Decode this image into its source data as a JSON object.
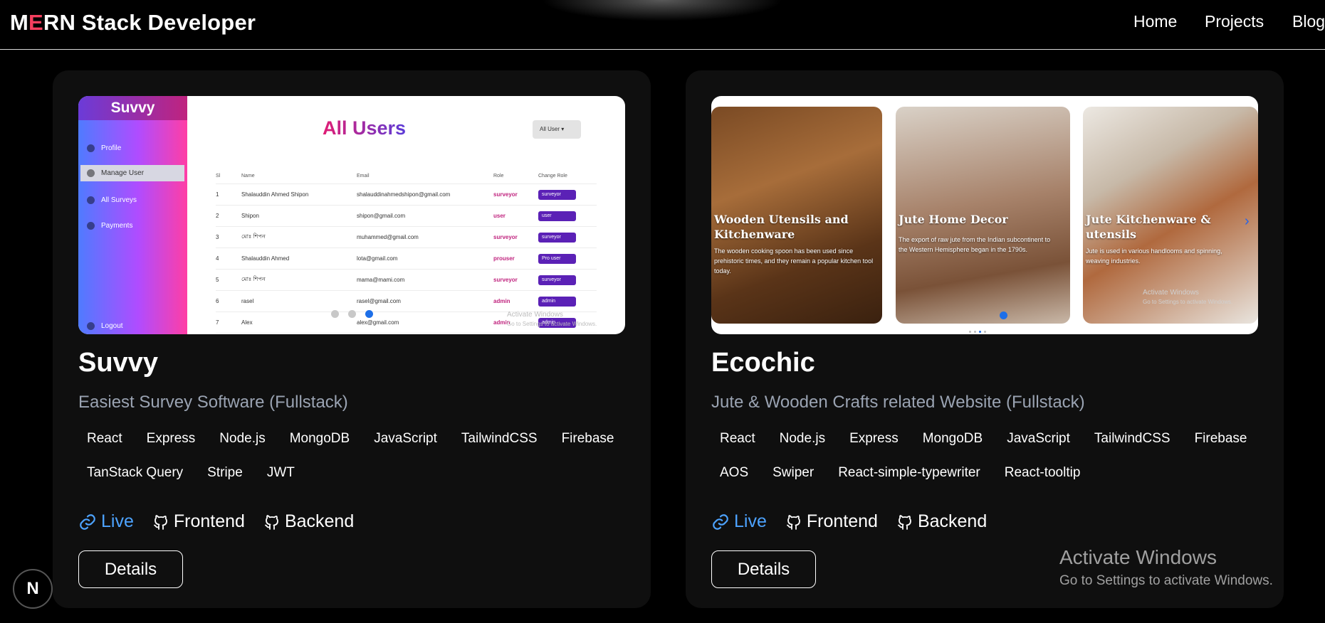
{
  "header": {
    "logo_first": "M",
    "logo_accent": "E",
    "logo_rest": "RN Stack Developer",
    "nav": [
      "Home",
      "Projects",
      "Blog"
    ]
  },
  "projects": [
    {
      "title": "Suvvy",
      "subtitle": "Easiest Survey Software (Fullstack)",
      "tags_row1": [
        "React",
        "Express",
        "Node.js",
        "MongoDB",
        "JavaScript",
        "TailwindCSS",
        "Firebase"
      ],
      "tags_row2": [
        "TanStack Query",
        "Stripe",
        "JWT"
      ],
      "links": {
        "live": "Live",
        "frontend": "Frontend",
        "backend": "Backend"
      },
      "details_label": "Details",
      "preview": {
        "brand": "Suvvy",
        "menu": [
          "Profile",
          "Manage User",
          "All Surveys",
          "Payments",
          "Logout"
        ],
        "page_title": "All Users",
        "filter": "All User",
        "columns": [
          "Sl",
          "Name",
          "Email",
          "Role",
          "Change Role"
        ],
        "rows": [
          [
            "1",
            "Shalauddin Ahmed Shipon",
            "shalauddinahmedshipon@gmail.com",
            "surveyor",
            "surveyor"
          ],
          [
            "2",
            "Shipon",
            "shipon@gmail.com",
            "user",
            "user"
          ],
          [
            "3",
            "মোঃ শিপন",
            "muhammed@gmail.com",
            "surveyor",
            "surveyor"
          ],
          [
            "4",
            "Shalauddin Ahmed",
            "lota@gmail.com",
            "prouser",
            "Pro user"
          ],
          [
            "5",
            "মোঃ শিপন",
            "mama@mami.com",
            "surveyor",
            "surveyor"
          ],
          [
            "6",
            "rasel",
            "rasel@gmail.com",
            "admin",
            "admin"
          ],
          [
            "7",
            "Alex",
            "alex@gmail.com",
            "admin",
            "admin"
          ]
        ],
        "watermark_1": "Activate Windows",
        "watermark_2": "Go to Settings to activate Windows."
      }
    },
    {
      "title": "Ecochic",
      "subtitle": "Jute & Wooden Crafts related Website (Fullstack)",
      "tags_row1": [
        "React",
        "Node.js",
        "Express",
        "MongoDB",
        "JavaScript",
        "TailwindCSS",
        "Firebase"
      ],
      "tags_row2": [
        "AOS",
        "Swiper",
        "React-simple-typewriter",
        "React-tooltip"
      ],
      "links": {
        "live": "Live",
        "frontend": "Frontend",
        "backend": "Backend"
      },
      "details_label": "Details",
      "preview": {
        "slides": [
          {
            "heading": "Wooden Utensils and Kitchenware",
            "text": "The wooden cooking spoon has been used since prehistoric times, and they remain a popular kitchen tool today."
          },
          {
            "heading": "Jute Home Decor",
            "text": "The export of raw jute from the Indian subcontinent to the Western Hemisphere began in the 1790s."
          },
          {
            "heading": "Jute Kitchenware & utensils",
            "text": "Jute is used in various handlooms and spinning, weaving industries."
          }
        ],
        "watermark_1": "Activate Windows",
        "watermark_2": "Go to Settings to activate Windows."
      }
    }
  ],
  "overlay": {
    "next_badge": "N",
    "activate_title": "Activate Windows",
    "activate_sub": "Go to Settings to activate Windows."
  }
}
